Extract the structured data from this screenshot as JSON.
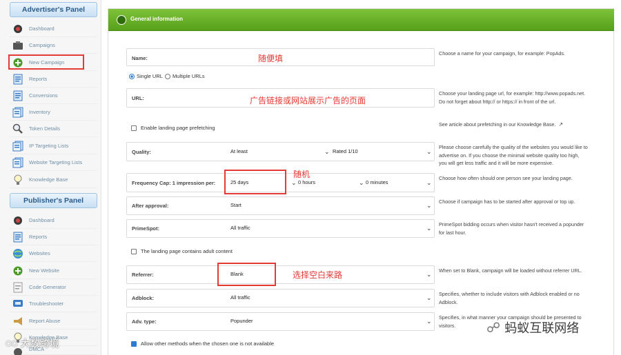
{
  "advertiser_panel": {
    "title": "Advertiser's Panel",
    "items": [
      {
        "label": "Dashboard",
        "icon": "dashboard-icon"
      },
      {
        "label": "Campaigns",
        "icon": "campaigns-icon"
      },
      {
        "label": "New Campaign",
        "icon": "plus-icon"
      },
      {
        "label": "Reports",
        "icon": "reports-icon"
      },
      {
        "label": "Conversions",
        "icon": "conversions-icon"
      },
      {
        "label": "Inventory",
        "icon": "inventory-icon"
      },
      {
        "label": "Token Details",
        "icon": "search-icon"
      },
      {
        "label": "IP Targeting Lists",
        "icon": "list-icon"
      },
      {
        "label": "Website Targeting Lists",
        "icon": "list-icon"
      },
      {
        "label": "Knowledge Base",
        "icon": "lightbulb-icon"
      }
    ]
  },
  "publisher_panel": {
    "title": "Publisher's Panel",
    "items": [
      {
        "label": "Dashboard",
        "icon": "dashboard-icon"
      },
      {
        "label": "Reports",
        "icon": "reports-icon"
      },
      {
        "label": "Websites",
        "icon": "globe-icon"
      },
      {
        "label": "New Website",
        "icon": "plus-icon"
      },
      {
        "label": "Code Generator",
        "icon": "code-icon"
      },
      {
        "label": "Troubleshooter",
        "icon": "troubleshooter-icon"
      },
      {
        "label": "Report Abuse",
        "icon": "megaphone-icon"
      },
      {
        "label": "Knowledge Base",
        "icon": "lightbulb-icon"
      },
      {
        "label": "DMCA",
        "icon": "dmca-icon"
      }
    ]
  },
  "section": {
    "title": "General information"
  },
  "form": {
    "name": {
      "label": "Name:",
      "help": "Choose a name for your campaign, for example: PopAds."
    },
    "url_type": {
      "single": "Single URL",
      "multiple": "Multiple URLs"
    },
    "url": {
      "label": "URL:",
      "help": "Choose your landing page url, for example: http://www.popads.net. Do not forget about http:// or https:// in front of the url."
    },
    "prefetch": {
      "label": "Enable landing page prefetching",
      "help": "See article about prefetching in our Knowledge Base."
    },
    "quality": {
      "label": "Quality:",
      "value1": "At least",
      "value2": "Rated 1/10",
      "help": "Please choose carefully the quality of the websites you would like to advertise on. If you choose the minimal website quality too high, you will get less traffic and it will be more expensive."
    },
    "frequency": {
      "label": "Frequency Cap: 1 impression per:",
      "days": "25 days",
      "hours": "0 hours",
      "minutes": "0 minutes",
      "help": "Choose how often should one person see your landing page."
    },
    "after_approval": {
      "label": "After approval:",
      "value": "Start",
      "help": "Choose if campaign has to be started after approval or top up."
    },
    "primespot": {
      "label": "PrimeSpot:",
      "value": "All traffic",
      "help": "PrimeSpot bidding occurs when visitor hasn't received a popunder for last hour."
    },
    "adult": {
      "label": "The landing page contains adult content"
    },
    "referrer": {
      "label": "Referrer:",
      "value": "Blank",
      "help": "When set to Blank, campaign will be loaded without referrer URL."
    },
    "adblock": {
      "label": "Adblock:",
      "value": "All traffic",
      "help": "Specifies, whether to include visitors with Adblock enabled or no Adblock."
    },
    "adv_type": {
      "label": "Adv. type:",
      "value": "Popunder",
      "help": "Specifies, in what manner your campaign should be presented to visitors."
    },
    "allow_other": {
      "label": "Allow other methods when the chosen one is not available"
    }
  },
  "annotations": {
    "name": "随便填",
    "url": "广告链接或网站展示广告的页面",
    "frequency": "随机",
    "referrer": "选择空白来路"
  },
  "watermarks": {
    "left": "大数跨境",
    "right": "蚂蚁互联网络"
  },
  "colors": {
    "accent_green": "#6ab42a",
    "highlight_red": "#e53935",
    "panel_blue": "#2a5b8c"
  }
}
